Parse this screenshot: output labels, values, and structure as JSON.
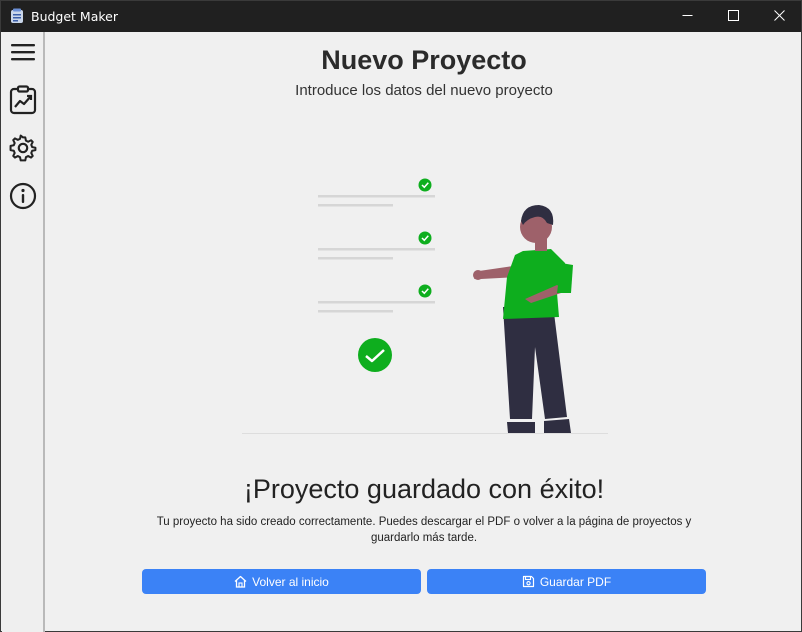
{
  "window": {
    "title": "Budget Maker",
    "icons": {
      "app": "budget-app-icon",
      "minimize": "minimize-icon",
      "maximize": "maximize-icon",
      "close": "close-icon"
    }
  },
  "sidebar": {
    "items": [
      {
        "name": "menu",
        "icon": "hamburger-menu-icon"
      },
      {
        "name": "reports",
        "icon": "clipboard-chart-icon"
      },
      {
        "name": "settings",
        "icon": "gear-icon"
      },
      {
        "name": "info",
        "icon": "info-icon"
      }
    ]
  },
  "main": {
    "title": "Nuevo Proyecto",
    "subtitle": "Introduce los datos del nuevo proyecto",
    "illustration": "person-checklist-illustration",
    "success_title": "¡Proyecto guardado con éxito!",
    "success_text": "Tu proyecto ha sido creado correctamente. Puedes descargar el PDF o volver a la página de proyectos y guardarlo más tarde.",
    "buttons": {
      "home_label": "Volver al inicio",
      "home_icon": "home-icon",
      "save_label": "Guardar PDF",
      "save_icon": "save-icon"
    }
  },
  "colors": {
    "accent": "#3b82f6",
    "success_green": "#0eae1e",
    "titlebar": "#202020",
    "background": "#f0f0f0"
  }
}
